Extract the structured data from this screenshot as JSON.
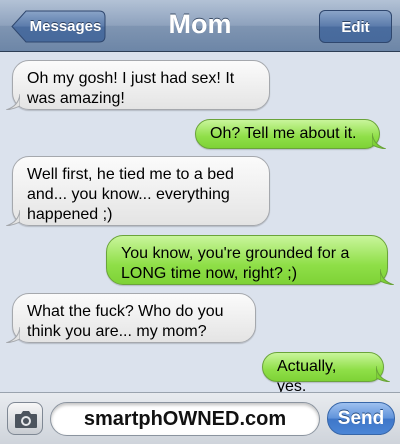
{
  "nav": {
    "back_label": "Messages",
    "title": "Mom",
    "edit_label": "Edit"
  },
  "messages": [
    {
      "side": "in",
      "text": "Oh my gosh! I just had sex! It was amazing!"
    },
    {
      "side": "out",
      "text": "Oh? Tell me about it."
    },
    {
      "side": "in",
      "text": "Well first, he tied me to a bed and... you know... everything happened ;)"
    },
    {
      "side": "out",
      "text": "You know, you're grounded for a LONG time now, right? ;)"
    },
    {
      "side": "in",
      "text": "What the fuck? Who do you think you are... my mom?"
    },
    {
      "side": "out",
      "text": "Actually, yes."
    }
  ],
  "composer": {
    "field_text": "smartphOWNED.com",
    "send_label": "Send",
    "camera_icon": "camera-icon"
  },
  "colors": {
    "incoming": "#e9e9e9",
    "outgoing": "#8fdf48",
    "navbar": "#7f95b2",
    "send": "#4b85d6"
  }
}
